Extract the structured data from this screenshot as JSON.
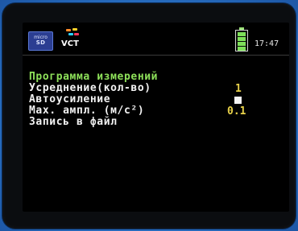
{
  "status_bar": {
    "sd_top": "micro",
    "sd_bottom": "SD",
    "app_badge": "VCT",
    "time": "17:47",
    "battery_icon": "battery-icon"
  },
  "menu": {
    "title": "Программа измерений",
    "items": [
      {
        "label": "Усреднение(кол-во)",
        "value": "1"
      },
      {
        "label": "Автоусиление",
        "value": "checkbox-checked"
      },
      {
        "label": "Max. ампл. (м/с²)",
        "value": "0.1"
      },
      {
        "label": "Запись в файл",
        "value": ""
      }
    ]
  },
  "colors": {
    "title": "#8ee15a",
    "value": "#e8d24a",
    "text": "#f2f2f2",
    "frame_bg": "#2b74c8"
  }
}
